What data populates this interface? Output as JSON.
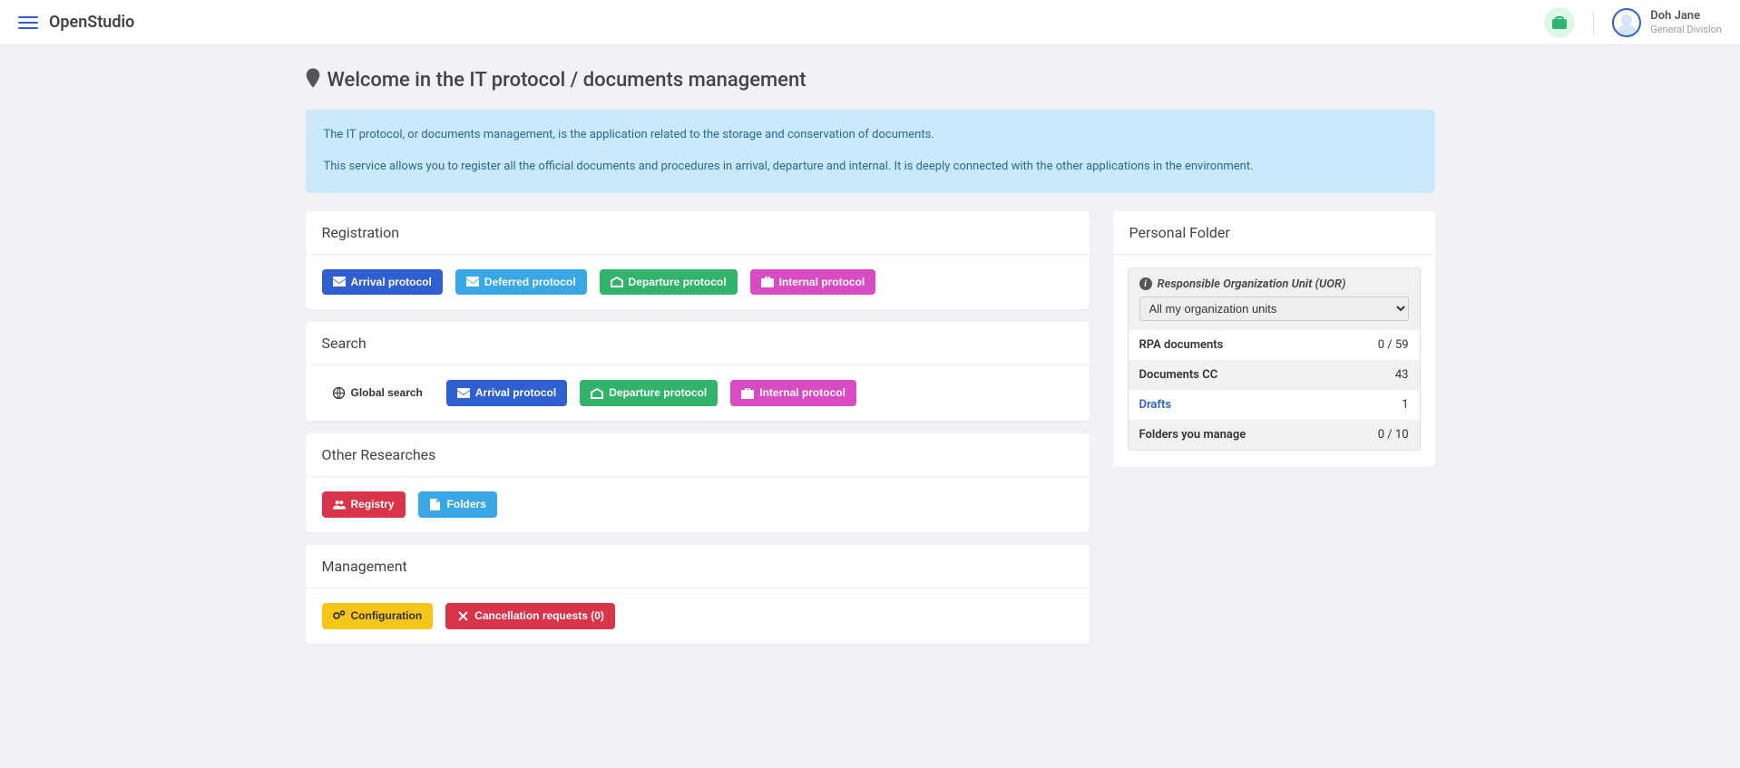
{
  "header": {
    "brand": "OpenStudio",
    "user_name": "Doh Jane",
    "user_sub": "General Division"
  },
  "page": {
    "title": "Welcome in the IT protocol / documents management",
    "banner_p1": "The IT protocol, or documents management, is the application related to the storage and conservation of documents.",
    "banner_p2": "This service allows you to register all the official documents and procedures in arrival, departure and internal. It is deeply connected with the other applications in the environment."
  },
  "sections": {
    "registration": {
      "title": "Registration",
      "btn_arrival": "Arrival protocol",
      "btn_deferred": "Deferred protocol",
      "btn_departure": "Departure protocol",
      "btn_internal": "Internal protocol"
    },
    "search": {
      "title": "Search",
      "btn_global": "Global search",
      "btn_arrival": "Arrival protocol",
      "btn_departure": "Departure protocol",
      "btn_internal": "Internal protocol"
    },
    "other": {
      "title": "Other Researches",
      "btn_registry": "Registry",
      "btn_folders": "Folders"
    },
    "management": {
      "title": "Management",
      "btn_config": "Configuration",
      "btn_cancel": "Cancellation requests (0)"
    }
  },
  "sidebar": {
    "title": "Personal Folder",
    "uor_label": "Responsible Organization Unit (UOR)",
    "uor_selected": "All my organization units",
    "rows": {
      "rpa_label": "RPA documents",
      "rpa_val": "0 / 59",
      "cc_label": "Documents CC",
      "cc_val": "43",
      "drafts_label": "Drafts",
      "drafts_val": "1",
      "folders_label": "Folders you manage",
      "folders_val": "0 / 10"
    }
  }
}
